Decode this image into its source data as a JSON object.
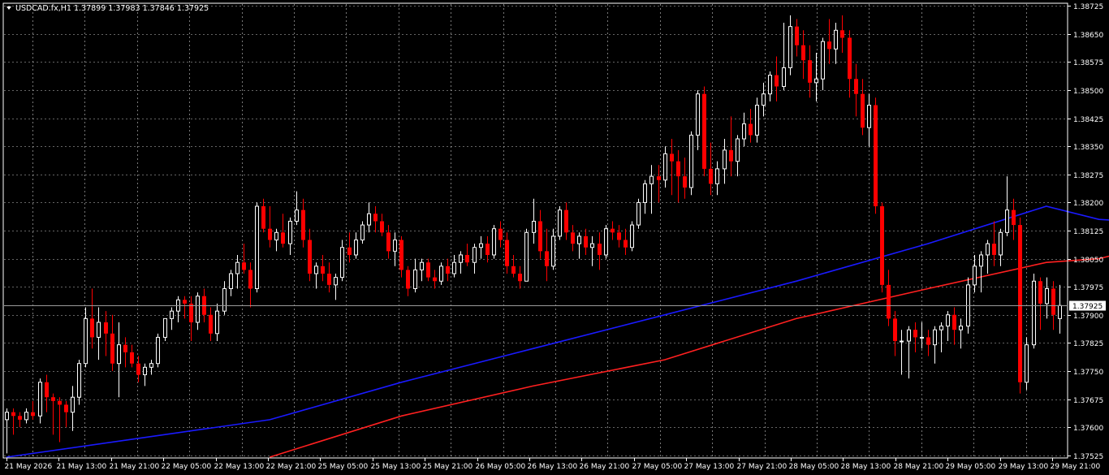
{
  "window": {
    "symbol_line": "USDCAD.fx,H1  1.37899 1.37983 1.37846 1.37925",
    "current_price_label": "1.37925"
  },
  "colors": {
    "background": "#000000",
    "grid": "#c8c8c8",
    "bull_candle": "#ffffff",
    "bear_candle": "#ff0000",
    "ma_fast": "#1a1aff",
    "ma_slow": "#ff2020",
    "price_line": "#9a9a9a"
  },
  "chart_data": {
    "type": "candlestick",
    "symbol": "USDCAD.fx",
    "timeframe": "H1",
    "ylim": [
      1.3752,
      1.3873
    ],
    "y_ticks": [
      "1.38725",
      "1.38650",
      "1.38575",
      "1.38500",
      "1.38425",
      "1.38350",
      "1.38275",
      "1.38200",
      "1.38125",
      "1.38050",
      "1.37975",
      "1.37900",
      "1.37825",
      "1.37750",
      "1.37675",
      "1.37600",
      "1.37525"
    ],
    "x_ticks": [
      "21 May 2026",
      "21 May 13:00",
      "21 May 21:00",
      "22 May 05:00",
      "22 May 13:00",
      "22 May 21:00",
      "25 May 05:00",
      "25 May 13:00",
      "25 May 21:00",
      "26 May 05:00",
      "26 May 13:00",
      "26 May 21:00",
      "27 May 05:00",
      "27 May 13:00",
      "27 May 21:00",
      "28 May 05:00",
      "28 May 13:00",
      "28 May 21:00",
      "29 May 05:00",
      "29 May 13:00",
      "29 May 21:00"
    ],
    "grid": true,
    "current_price": 1.37925,
    "candles": [
      [
        1.3762,
        1.3765,
        1.3753,
        1.3764
      ],
      [
        1.3764,
        1.3765,
        1.3758,
        1.3763
      ],
      [
        1.3763,
        1.3764,
        1.376,
        1.3762
      ],
      [
        1.3762,
        1.3765,
        1.3761,
        1.3764
      ],
      [
        1.3764,
        1.3767,
        1.3762,
        1.3763
      ],
      [
        1.3763,
        1.3773,
        1.3761,
        1.3772
      ],
      [
        1.3772,
        1.3774,
        1.3764,
        1.3768
      ],
      [
        1.3768,
        1.3769,
        1.3758,
        1.3767
      ],
      [
        1.3767,
        1.3768,
        1.3756,
        1.3766
      ],
      [
        1.3766,
        1.3767,
        1.376,
        1.3764
      ],
      [
        1.3764,
        1.3771,
        1.3759,
        1.3768
      ],
      [
        1.3768,
        1.3778,
        1.3766,
        1.3777
      ],
      [
        1.3777,
        1.3792,
        1.3776,
        1.3789
      ],
      [
        1.3789,
        1.3797,
        1.3781,
        1.3784
      ],
      [
        1.3784,
        1.3792,
        1.3778,
        1.3788
      ],
      [
        1.3788,
        1.3791,
        1.3779,
        1.3785
      ],
      [
        1.3785,
        1.379,
        1.3775,
        1.3777
      ],
      [
        1.3777,
        1.3788,
        1.3768,
        1.3782
      ],
      [
        1.3782,
        1.3784,
        1.3776,
        1.378
      ],
      [
        1.378,
        1.3782,
        1.3776,
        1.3777
      ],
      [
        1.3777,
        1.3779,
        1.3772,
        1.3774
      ],
      [
        1.3774,
        1.3777,
        1.3771,
        1.3776
      ],
      [
        1.3776,
        1.3778,
        1.3774,
        1.3777
      ],
      [
        1.3777,
        1.3785,
        1.3776,
        1.3784
      ],
      [
        1.3784,
        1.3789,
        1.3783,
        1.3789
      ],
      [
        1.3789,
        1.3792,
        1.3786,
        1.3791
      ],
      [
        1.3791,
        1.3795,
        1.3788,
        1.3794
      ],
      [
        1.3794,
        1.3795,
        1.3789,
        1.3793
      ],
      [
        1.3793,
        1.3795,
        1.3783,
        1.3788
      ],
      [
        1.3788,
        1.3796,
        1.3786,
        1.3795
      ],
      [
        1.3795,
        1.3797,
        1.3788,
        1.379
      ],
      [
        1.379,
        1.3792,
        1.3783,
        1.3785
      ],
      [
        1.3785,
        1.3793,
        1.3783,
        1.3791
      ],
      [
        1.3791,
        1.3799,
        1.379,
        1.3797
      ],
      [
        1.3797,
        1.3802,
        1.3795,
        1.3801
      ],
      [
        1.3801,
        1.3806,
        1.3797,
        1.3804
      ],
      [
        1.3804,
        1.3809,
        1.3801,
        1.3802
      ],
      [
        1.3802,
        1.3804,
        1.3792,
        1.3797
      ],
      [
        1.3797,
        1.382,
        1.3796,
        1.3819
      ],
      [
        1.3819,
        1.3821,
        1.3812,
        1.3813
      ],
      [
        1.3813,
        1.3819,
        1.3808,
        1.381
      ],
      [
        1.381,
        1.3813,
        1.3807,
        1.3812
      ],
      [
        1.3812,
        1.3817,
        1.3808,
        1.3809
      ],
      [
        1.3809,
        1.3816,
        1.3806,
        1.3815
      ],
      [
        1.3815,
        1.3823,
        1.3814,
        1.3818
      ],
      [
        1.3818,
        1.3821,
        1.3808,
        1.381
      ],
      [
        1.381,
        1.3813,
        1.3799,
        1.3801
      ],
      [
        1.3801,
        1.3804,
        1.3797,
        1.3803
      ],
      [
        1.3803,
        1.3806,
        1.3799,
        1.3801
      ],
      [
        1.3801,
        1.3804,
        1.3796,
        1.3798
      ],
      [
        1.3798,
        1.3801,
        1.3794,
        1.38
      ],
      [
        1.38,
        1.381,
        1.3799,
        1.3808
      ],
      [
        1.3808,
        1.3812,
        1.3804,
        1.3806
      ],
      [
        1.3806,
        1.3812,
        1.3805,
        1.381
      ],
      [
        1.381,
        1.3815,
        1.3809,
        1.3814
      ],
      [
        1.3814,
        1.382,
        1.3812,
        1.3817
      ],
      [
        1.3817,
        1.3819,
        1.3812,
        1.3815
      ],
      [
        1.3815,
        1.3817,
        1.3811,
        1.3812
      ],
      [
        1.3812,
        1.3814,
        1.3805,
        1.3807
      ],
      [
        1.3807,
        1.3812,
        1.3803,
        1.381
      ],
      [
        1.381,
        1.3811,
        1.38,
        1.3802
      ],
      [
        1.3802,
        1.3803,
        1.3795,
        1.3797
      ],
      [
        1.3797,
        1.3805,
        1.3796,
        1.3802
      ],
      [
        1.3802,
        1.3805,
        1.3799,
        1.3804
      ],
      [
        1.3804,
        1.3805,
        1.3799,
        1.38
      ],
      [
        1.38,
        1.3802,
        1.3797,
        1.3799
      ],
      [
        1.3799,
        1.3804,
        1.3798,
        1.3803
      ],
      [
        1.3803,
        1.3805,
        1.3799,
        1.3801
      ],
      [
        1.3801,
        1.3806,
        1.38,
        1.3804
      ],
      [
        1.3804,
        1.3807,
        1.3801,
        1.3806
      ],
      [
        1.3806,
        1.3809,
        1.3803,
        1.3804
      ],
      [
        1.3804,
        1.3809,
        1.3801,
        1.3808
      ],
      [
        1.3808,
        1.3811,
        1.3805,
        1.3809
      ],
      [
        1.3809,
        1.3811,
        1.3804,
        1.3806
      ],
      [
        1.3806,
        1.3814,
        1.3805,
        1.3813
      ],
      [
        1.3813,
        1.3815,
        1.3808,
        1.381
      ],
      [
        1.381,
        1.3812,
        1.3801,
        1.3803
      ],
      [
        1.3803,
        1.3806,
        1.38,
        1.3801
      ],
      [
        1.3801,
        1.3803,
        1.3797,
        1.3799
      ],
      [
        1.3799,
        1.3813,
        1.3799,
        1.3812
      ],
      [
        1.3812,
        1.3821,
        1.3809,
        1.3815
      ],
      [
        1.3815,
        1.3818,
        1.3805,
        1.3807
      ],
      [
        1.3807,
        1.3813,
        1.3799,
        1.3803
      ],
      [
        1.3803,
        1.3813,
        1.3802,
        1.3811
      ],
      [
        1.3811,
        1.3819,
        1.381,
        1.3818
      ],
      [
        1.3818,
        1.382,
        1.381,
        1.3812
      ],
      [
        1.3812,
        1.3814,
        1.3807,
        1.3809
      ],
      [
        1.3809,
        1.3812,
        1.3805,
        1.3811
      ],
      [
        1.3811,
        1.3813,
        1.3806,
        1.3808
      ],
      [
        1.3808,
        1.3811,
        1.3803,
        1.3809
      ],
      [
        1.3809,
        1.3812,
        1.3802,
        1.3806
      ],
      [
        1.3806,
        1.3814,
        1.3805,
        1.3813
      ],
      [
        1.3813,
        1.3815,
        1.381,
        1.3812
      ],
      [
        1.3812,
        1.3814,
        1.3808,
        1.381
      ],
      [
        1.381,
        1.3813,
        1.3806,
        1.3808
      ],
      [
        1.3808,
        1.3815,
        1.3807,
        1.3814
      ],
      [
        1.3814,
        1.3821,
        1.3813,
        1.382
      ],
      [
        1.382,
        1.3826,
        1.3817,
        1.3825
      ],
      [
        1.3825,
        1.383,
        1.3817,
        1.3827
      ],
      [
        1.3827,
        1.383,
        1.382,
        1.3826
      ],
      [
        1.3826,
        1.3835,
        1.3824,
        1.3833
      ],
      [
        1.3833,
        1.3837,
        1.3822,
        1.3831
      ],
      [
        1.3831,
        1.3834,
        1.382,
        1.3827
      ],
      [
        1.3827,
        1.3832,
        1.3821,
        1.3824
      ],
      [
        1.3824,
        1.3839,
        1.3822,
        1.3838
      ],
      [
        1.3838,
        1.385,
        1.3834,
        1.3849
      ],
      [
        1.3849,
        1.3851,
        1.3827,
        1.3829
      ],
      [
        1.3829,
        1.3836,
        1.3822,
        1.3825
      ],
      [
        1.3825,
        1.3831,
        1.3822,
        1.3829
      ],
      [
        1.3829,
        1.3837,
        1.3825,
        1.3834
      ],
      [
        1.3834,
        1.3843,
        1.3827,
        1.3831
      ],
      [
        1.3831,
        1.3838,
        1.3827,
        1.3837
      ],
      [
        1.3837,
        1.3844,
        1.3835,
        1.3841
      ],
      [
        1.3841,
        1.3845,
        1.3836,
        1.3838
      ],
      [
        1.3838,
        1.3848,
        1.3836,
        1.3846
      ],
      [
        1.3846,
        1.3852,
        1.3843,
        1.3849
      ],
      [
        1.3849,
        1.3855,
        1.3847,
        1.3854
      ],
      [
        1.3854,
        1.3859,
        1.3847,
        1.3851
      ],
      [
        1.3851,
        1.3868,
        1.385,
        1.3856
      ],
      [
        1.3856,
        1.387,
        1.3854,
        1.3867
      ],
      [
        1.3867,
        1.3869,
        1.3859,
        1.3862
      ],
      [
        1.3862,
        1.3866,
        1.3853,
        1.3858
      ],
      [
        1.3858,
        1.3862,
        1.3848,
        1.3852
      ],
      [
        1.3852,
        1.386,
        1.3847,
        1.3853
      ],
      [
        1.3853,
        1.3864,
        1.385,
        1.3863
      ],
      [
        1.3863,
        1.3869,
        1.3857,
        1.3861
      ],
      [
        1.3861,
        1.3868,
        1.3857,
        1.3866
      ],
      [
        1.3866,
        1.387,
        1.386,
        1.3864
      ],
      [
        1.3864,
        1.3866,
        1.3848,
        1.3853
      ],
      [
        1.3853,
        1.3857,
        1.3843,
        1.3849
      ],
      [
        1.3849,
        1.3853,
        1.3838,
        1.384
      ],
      [
        1.384,
        1.3849,
        1.3835,
        1.3846
      ],
      [
        1.3846,
        1.3848,
        1.3817,
        1.3819
      ],
      [
        1.3819,
        1.382,
        1.3796,
        1.3798
      ],
      [
        1.3798,
        1.3802,
        1.3787,
        1.3789
      ],
      [
        1.3789,
        1.3791,
        1.3779,
        1.3783
      ],
      [
        1.3783,
        1.3786,
        1.3774,
        1.3783
      ],
      [
        1.3783,
        1.3787,
        1.3773,
        1.3786
      ],
      [
        1.3786,
        1.3788,
        1.378,
        1.3784
      ],
      [
        1.3784,
        1.3788,
        1.3781,
        1.3784
      ],
      [
        1.3784,
        1.3786,
        1.3779,
        1.3782
      ],
      [
        1.3782,
        1.3787,
        1.3777,
        1.3786
      ],
      [
        1.3786,
        1.3788,
        1.378,
        1.3787
      ],
      [
        1.3787,
        1.3791,
        1.3783,
        1.379
      ],
      [
        1.379,
        1.3792,
        1.3782,
        1.3786
      ],
      [
        1.3786,
        1.3789,
        1.3781,
        1.3787
      ],
      [
        1.3787,
        1.38,
        1.3785,
        1.3798
      ],
      [
        1.3798,
        1.3806,
        1.3796,
        1.3803
      ],
      [
        1.3803,
        1.3807,
        1.3796,
        1.3806
      ],
      [
        1.3806,
        1.381,
        1.3801,
        1.3809
      ],
      [
        1.3809,
        1.3815,
        1.3803,
        1.3806
      ],
      [
        1.3806,
        1.3813,
        1.3803,
        1.3812
      ],
      [
        1.3812,
        1.3827,
        1.3811,
        1.3818
      ],
      [
        1.3818,
        1.3821,
        1.381,
        1.3814
      ],
      [
        1.3814,
        1.3816,
        1.3769,
        1.3772
      ],
      [
        1.3772,
        1.3784,
        1.377,
        1.3782
      ],
      [
        1.3782,
        1.3801,
        1.3781,
        1.3799
      ],
      [
        1.3799,
        1.38,
        1.3786,
        1.3793
      ],
      [
        1.3793,
        1.38,
        1.3789,
        1.3797
      ],
      [
        1.3797,
        1.3799,
        1.3786,
        1.379
      ],
      [
        1.3789,
        1.3798,
        1.3785,
        1.37925
      ]
    ],
    "ma_fast": [
      [
        0,
        1.3752
      ],
      [
        20,
        1.3757
      ],
      [
        40,
        1.3762
      ],
      [
        60,
        1.3772
      ],
      [
        80,
        1.3781
      ],
      [
        100,
        1.379
      ],
      [
        120,
        1.3799
      ],
      [
        140,
        1.3809
      ],
      [
        158,
        1.3819
      ],
      [
        166,
        1.38155
      ],
      [
        180,
        1.3814
      ],
      [
        184,
        1.3814
      ]
    ],
    "ma_slow": [
      [
        40,
        1.3752
      ],
      [
        60,
        1.3763
      ],
      [
        80,
        1.3771
      ],
      [
        100,
        1.3778
      ],
      [
        120,
        1.3789
      ],
      [
        140,
        1.3797
      ],
      [
        158,
        1.3804
      ],
      [
        166,
        1.3805
      ],
      [
        180,
        1.3811
      ],
      [
        184,
        1.3811
      ]
    ]
  }
}
